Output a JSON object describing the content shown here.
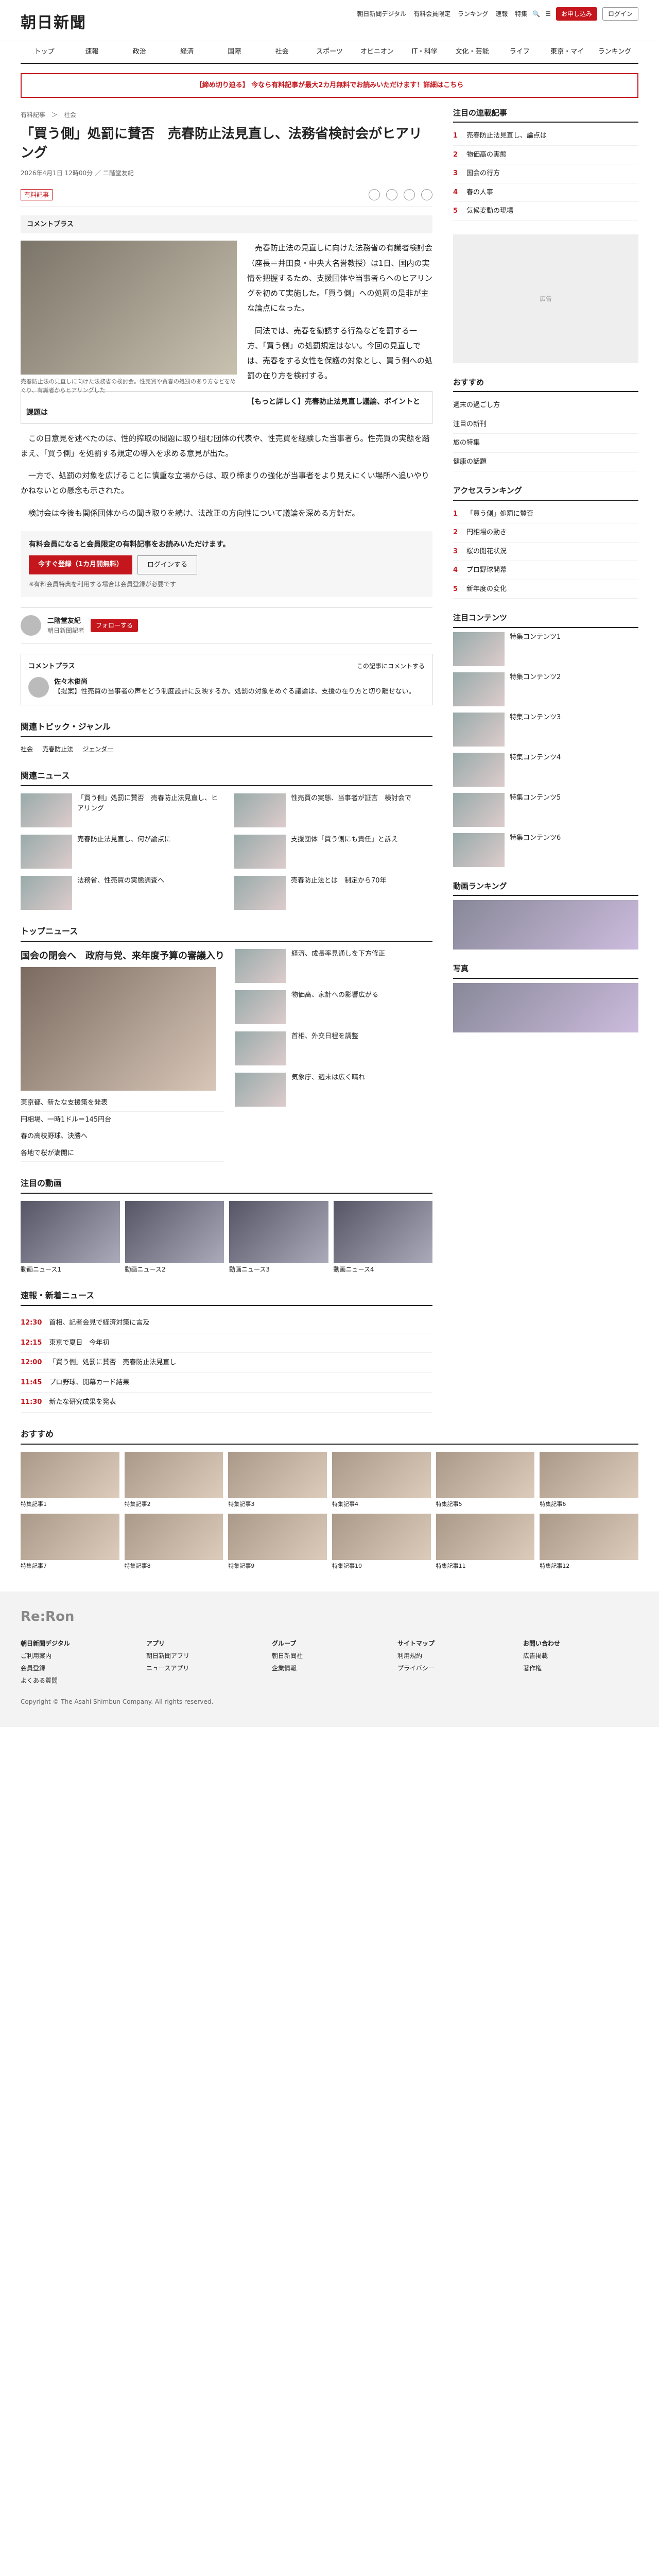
{
  "header": {
    "logo": "朝日新聞",
    "util_links": [
      "朝日新聞デジタル",
      "有料会員限定",
      "ランキング",
      "速報",
      "特集"
    ],
    "register": "お申し込み",
    "login": "ログイン"
  },
  "nav": [
    "トップ",
    "速報",
    "政治",
    "経済",
    "国際",
    "社会",
    "スポーツ",
    "オピニオン",
    "IT・科学",
    "文化・芸能",
    "ライフ",
    "東京・マイ",
    "ランキング"
  ],
  "banner": "【締め切り迫る】 今なら有料記事が最大2カ月無料でお読みいただけます！詳細はこちら",
  "article": {
    "breadcrumb": "有料記事　＞　社会",
    "title": "「買う側」処罰に賛否　売春防止法見直し、法務省検討会がヒアリング",
    "date": "2026年4月1日 12時00分",
    "byline": "二階堂友紀",
    "share_label": "有料記事",
    "comment_plus": "コメントプラス",
    "photo_caption": "売春防止法の見直しに向けた法務省の検討会。性売買や買春の処罰のあり方などをめぐり、有識者からヒアリングした",
    "summary_label": "【もっと詳しく】売春防止法見直し議論、ポイントと課題は",
    "paragraphs": [
      "売春防止法の見直しに向けた法務省の有識者検討会（座長＝井田良・中央大名誉教授）は1日、国内の実情を把握するため、支援団体や当事者らへのヒアリングを初めて実施した。「買う側」への処罰の是非が主な論点になった。",
      "同法では、売春を勧誘する行為などを罰する一方、「買う側」の処罰規定はない。今回の見直しでは、売春をする女性を保護の対象とし、買う側への処罰の在り方を検討する。",
      "この日意見を述べたのは、性的搾取の問題に取り組む団体の代表や、性売買を経験した当事者ら。性売買の実態を踏まえ、「買う側」を処罰する規定の導入を求める意見が出た。",
      "一方で、処罰の対象を広げることに慎重な立場からは、取り締まりの強化が当事者をより見えにくい場所へ追いやりかねないとの懸念も示された。",
      "検討会は今後も関係団体からの聞き取りを続け、法改正の方向性について議論を深める方針だ。"
    ],
    "paywall": {
      "title": "有料会員になると会員限定の有料記事をお読みいただけます。",
      "subscribe": "今すぐ登録（1カ月間無料）",
      "login": "ログインする",
      "note": "※有料会員特典を利用する場合は会員登録が必要です"
    },
    "author": {
      "name": "二階堂友紀",
      "desc": "朝日新聞記者",
      "follow": "フォローする"
    },
    "comment_box": {
      "title": "コメントプラス",
      "count": "この記事にコメントする",
      "commenter": "佐々木俊尚",
      "comment": "【提案】性売買の当事者の声をどう制度設計に反映するか。処罰の対象をめぐる議論は、支援の在り方と切り離せない。"
    }
  },
  "topics": {
    "title": "関連トピック・ジャンル",
    "tags": [
      "社会",
      "売春防止法",
      "ジェンダー"
    ]
  },
  "related": {
    "title": "関連ニュース",
    "items": [
      "「買う側」処罰に賛否　売春防止法見直し、ヒアリング",
      "性売買の実態、当事者が証言　検討会で",
      "売春防止法見直し、何が論点に",
      "支援団体「買う側にも責任」と訴え",
      "法務省、性売買の実態調査へ",
      "売春防止法とは　制定から70年"
    ]
  },
  "topnews": {
    "title": "トップニュース",
    "lead": "国会の閉会へ　政府与党、来年度予算の審議入り",
    "subs": [
      "東京都、新たな支援策を発表",
      "円相場、一時1ドル＝145円台",
      "春の高校野球、決勝へ",
      "各地で桜が満開に"
    ],
    "right": [
      "経済、成長率見通しを下方修正",
      "物価高、家計への影響広がる",
      "首相、外交日程を調整",
      "気象庁、週末は広く晴れ"
    ]
  },
  "video": {
    "title": "注目の動画",
    "caps": [
      "動画ニュース1",
      "動画ニュース2",
      "動画ニュース3",
      "動画ニュース4"
    ]
  },
  "newsfeed": {
    "title": "速報・新着ニュース",
    "items": [
      {
        "time": "12:30",
        "text": "首相、記者会見で経済対策に言及"
      },
      {
        "time": "12:15",
        "text": "東京で夏日　今年初"
      },
      {
        "time": "12:00",
        "text": "「買う側」処罰に賛否　売春防止法見直し"
      },
      {
        "time": "11:45",
        "text": "プロ野球、開幕カード結果"
      },
      {
        "time": "11:30",
        "text": "新たな研究成果を発表"
      }
    ]
  },
  "promo": {
    "title": "おすすめ",
    "items": [
      "特集記事1",
      "特集記事2",
      "特集記事3",
      "特集記事4",
      "特集記事5",
      "特集記事6",
      "特集記事7",
      "特集記事8",
      "特集記事9",
      "特集記事10",
      "特集記事11",
      "特集記事12"
    ]
  },
  "side": {
    "ranking_title": "注目の連載記事",
    "ranking": [
      "売春防止法見直し、論点は",
      "物価高の実態",
      "国会の行方",
      "春の人事",
      "気候変動の現場"
    ],
    "rec_title": "おすすめ",
    "rec": [
      "週末の過ごし方",
      "注目の新刊",
      "旅の特集",
      "健康の話題"
    ],
    "access_title": "アクセスランキング",
    "access": [
      "「買う側」処罰に賛否",
      "円相場の動き",
      "桜の開花状況",
      "プロ野球開幕",
      "新年度の変化"
    ],
    "content_title": "注目コンテンツ",
    "content": [
      "特集コンテンツ1",
      "特集コンテンツ2",
      "特集コンテンツ3",
      "特集コンテンツ4",
      "特集コンテンツ5",
      "特集コンテンツ6"
    ],
    "video_rank_title": "動画ランキング",
    "photo_title": "写真",
    "ad": "広告"
  },
  "footer": {
    "reiron": "Re:Ron",
    "cols": [
      [
        "朝日新聞デジタル",
        "ご利用案内",
        "会員登録",
        "よくある質問"
      ],
      [
        "アプリ",
        "朝日新聞アプリ",
        "ニュースアプリ"
      ],
      [
        "グループ",
        "朝日新聞社",
        "企業情報"
      ],
      [
        "サイトマップ",
        "利用規約",
        "プライバシー"
      ],
      [
        "お問い合わせ",
        "広告掲載",
        "著作権"
      ]
    ],
    "copyright": "Copyright © The Asahi Shimbun Company. All rights reserved."
  }
}
